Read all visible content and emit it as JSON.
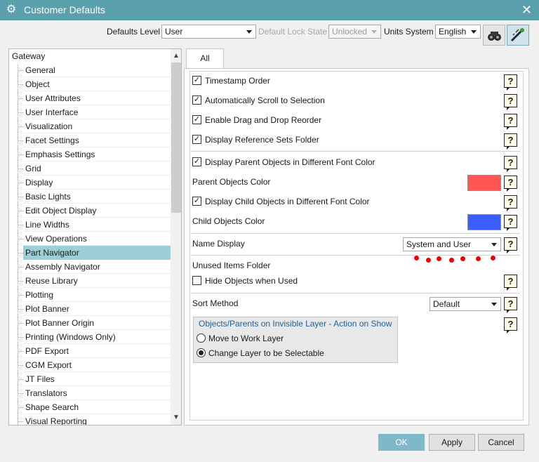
{
  "window": {
    "title": "Customer Defaults"
  },
  "toolbar": {
    "defaults_level_label": "Defaults Level",
    "defaults_level_value": "User",
    "lock_state_label": "Default Lock State",
    "lock_state_value": "Unlocked",
    "units_label": "Units System",
    "units_value": "English"
  },
  "tree": {
    "root": "Gateway",
    "items": [
      "General",
      "Object",
      "User Attributes",
      "User Interface",
      "Visualization",
      "Facet Settings",
      "Emphasis Settings",
      "Grid",
      "Display",
      "Basic Lights",
      "Edit Object Display",
      "Line Widths",
      "View Operations",
      "Part Navigator",
      "Assembly Navigator",
      "Reuse Library",
      "Plotting",
      "Plot Banner",
      "Plot Banner Origin",
      "Printing (Windows Only)",
      "PDF Export",
      "CGM Export",
      "JT Files",
      "Translators",
      "Shape Search",
      "Visual Reporting"
    ],
    "selected": "Part Navigator"
  },
  "tab": {
    "label": "All"
  },
  "settings": {
    "timestamp_order": "Timestamp Order",
    "auto_scroll": "Automatically Scroll to Selection",
    "drag_drop": "Enable Drag and Drop Reorder",
    "ref_sets_folder": "Display Reference Sets Folder",
    "parent_font": "Display Parent Objects in Different Font Color",
    "parent_color_label": "Parent Objects Color",
    "parent_color": "#ff5555",
    "child_font": "Display Child Objects in Different Font Color",
    "child_color_label": "Child Objects Color",
    "child_color": "#3d5eff",
    "name_display_label": "Name Display",
    "name_display_value": "System and User",
    "unused_folder_label": "Unused Items Folder",
    "hide_objects": "Hide Objects when Used",
    "sort_method_label": "Sort Method",
    "sort_method_value": "Default",
    "layer_group_title": "Objects/Parents on Invisible Layer - Action on Show",
    "move_work_layer": "Move to Work Layer",
    "change_selectable": "Change Layer to be Selectable",
    "help_mark": "?",
    "check_mark": "✓"
  },
  "buttons": {
    "ok": "OK",
    "apply": "Apply",
    "cancel": "Cancel"
  },
  "colors": {
    "titlebar": "#5aa0ad",
    "selection": "#9ccfd8",
    "ok_button": "#7fb9c9",
    "annotation_dots": "#e00000"
  }
}
